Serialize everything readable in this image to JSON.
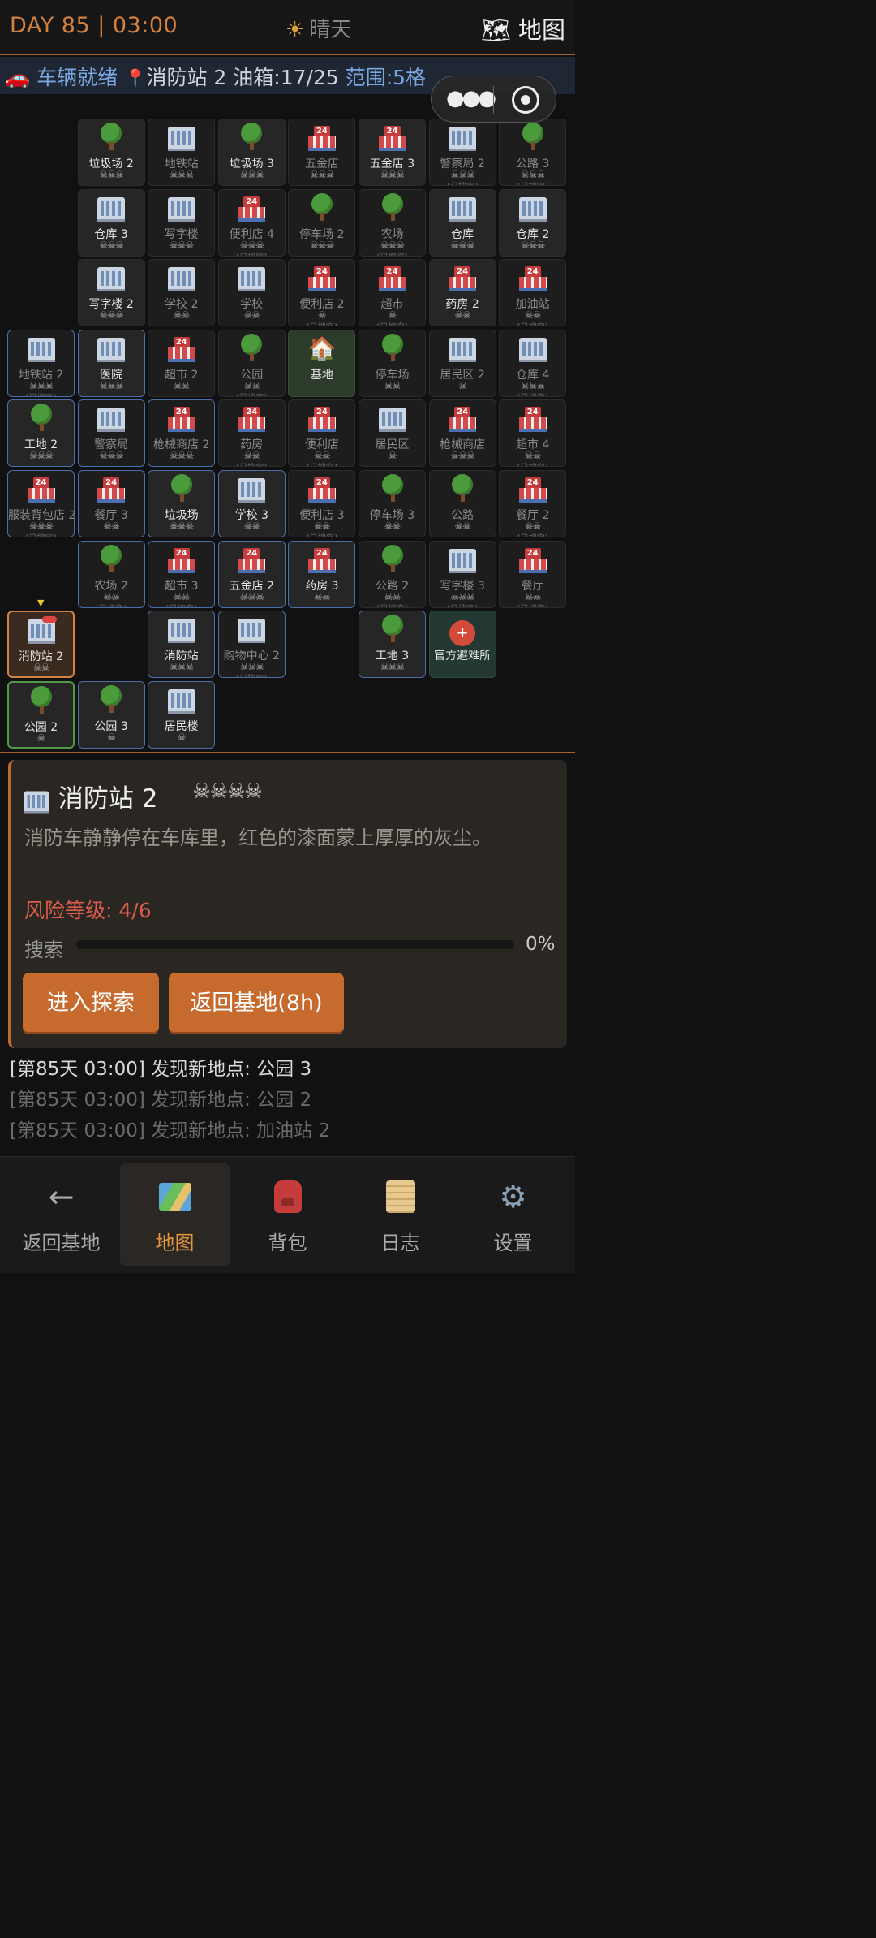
{
  "header": {
    "day_time": "DAY 85 | 03:00",
    "weather": "晴天",
    "map_label": "地图"
  },
  "status": {
    "ready": "车辆就绪",
    "location": "消防站 2",
    "fuel": "油箱:17/25",
    "range": "范围:5格"
  },
  "grid_cells": [
    {
      "c": 1,
      "r": 0,
      "icon": "tree",
      "name": "垃圾场 2",
      "risk": "☠☠☠",
      "dim": false
    },
    {
      "c": 2,
      "r": 0,
      "icon": "building",
      "name": "地铁站",
      "risk": "☠☠☠",
      "dim": true
    },
    {
      "c": 3,
      "r": 0,
      "icon": "tree",
      "name": "垃圾场 3",
      "risk": "☠☠☠",
      "dim": false
    },
    {
      "c": 4,
      "r": 0,
      "icon": "shop",
      "name": "五金店",
      "risk": "☠☠☠",
      "dim": true
    },
    {
      "c": 5,
      "r": 0,
      "icon": "shop",
      "name": "五金店 3",
      "risk": "☠☠☠",
      "dim": false
    },
    {
      "c": 6,
      "r": 0,
      "icon": "building",
      "name": "警察局 2",
      "risk": "☠☠☠",
      "dim": true,
      "searched": "[已搜空]"
    },
    {
      "c": 7,
      "r": 0,
      "icon": "tree",
      "name": "公路 3",
      "risk": "☠☠☠",
      "dim": true,
      "searched": "[已搜空]"
    },
    {
      "c": 1,
      "r": 1,
      "icon": "building",
      "name": "仓库 3",
      "risk": "☠☠☠",
      "dim": false
    },
    {
      "c": 2,
      "r": 1,
      "icon": "building",
      "name": "写字楼",
      "risk": "☠☠☠",
      "dim": true
    },
    {
      "c": 3,
      "r": 1,
      "icon": "shop",
      "name": "便利店 4",
      "risk": "☠☠☠",
      "dim": true,
      "searched": "[已搜空]"
    },
    {
      "c": 4,
      "r": 1,
      "icon": "tree",
      "name": "停车场 2",
      "risk": "☠☠☠",
      "dim": true
    },
    {
      "c": 5,
      "r": 1,
      "icon": "tree",
      "name": "农场",
      "risk": "☠☠☠",
      "dim": true,
      "searched": "[已搜空]"
    },
    {
      "c": 6,
      "r": 1,
      "icon": "building",
      "name": "仓库",
      "risk": "☠☠☠",
      "dim": false
    },
    {
      "c": 7,
      "r": 1,
      "icon": "building",
      "name": "仓库 2",
      "risk": "☠☠☠",
      "dim": false
    },
    {
      "c": 1,
      "r": 2,
      "icon": "building",
      "name": "写字楼 2",
      "risk": "☠☠☠",
      "dim": false
    },
    {
      "c": 2,
      "r": 2,
      "icon": "building",
      "name": "学校 2",
      "risk": "☠☠",
      "dim": true
    },
    {
      "c": 3,
      "r": 2,
      "icon": "building",
      "name": "学校",
      "risk": "☠☠",
      "dim": true
    },
    {
      "c": 4,
      "r": 2,
      "icon": "shop",
      "name": "便利店 2",
      "risk": "☠",
      "dim": true,
      "searched": "[已搜空]"
    },
    {
      "c": 5,
      "r": 2,
      "icon": "shop",
      "name": "超市",
      "risk": "☠",
      "dim": true,
      "searched": "[已搜空]"
    },
    {
      "c": 6,
      "r": 2,
      "icon": "shop",
      "name": "药房 2",
      "risk": "☠☠",
      "dim": false
    },
    {
      "c": 7,
      "r": 2,
      "icon": "shop",
      "name": "加油站",
      "risk": "☠☠",
      "dim": true,
      "searched": "[已搜空]"
    },
    {
      "c": 0,
      "r": 3,
      "icon": "building",
      "name": "地铁站 2",
      "risk": "☠☠☠",
      "dim": true,
      "blue": true,
      "searched": "[已搜空]"
    },
    {
      "c": 1,
      "r": 3,
      "icon": "building",
      "name": "医院",
      "risk": "☠☠☠",
      "dim": false,
      "blue": true
    },
    {
      "c": 2,
      "r": 3,
      "icon": "shop",
      "name": "超市 2",
      "risk": "☠☠",
      "dim": true
    },
    {
      "c": 3,
      "r": 3,
      "icon": "tree",
      "name": "公园",
      "risk": "☠☠",
      "dim": true,
      "searched": "[已搜空]"
    },
    {
      "c": 4,
      "r": 3,
      "icon": "house",
      "name": "基地",
      "risk": "",
      "dim": false,
      "base": true
    },
    {
      "c": 5,
      "r": 3,
      "icon": "tree",
      "name": "停车场",
      "risk": "☠☠",
      "dim": true
    },
    {
      "c": 6,
      "r": 3,
      "icon": "building",
      "name": "居民区 2",
      "risk": "☠",
      "dim": true
    },
    {
      "c": 7,
      "r": 3,
      "icon": "building",
      "name": "仓库 4",
      "risk": "☠☠☠",
      "dim": true,
      "searched": "[已搜空]"
    },
    {
      "c": 0,
      "r": 4,
      "icon": "tree",
      "name": "工地 2",
      "risk": "☠☠☠",
      "dim": false,
      "blue": true
    },
    {
      "c": 1,
      "r": 4,
      "icon": "building",
      "name": "警察局",
      "risk": "☠☠☠",
      "dim": true,
      "blue": true
    },
    {
      "c": 2,
      "r": 4,
      "icon": "shop",
      "name": "枪械商店 2",
      "risk": "☠☠☠",
      "dim": true,
      "blue": true
    },
    {
      "c": 3,
      "r": 4,
      "icon": "shop",
      "name": "药房",
      "risk": "☠☠",
      "dim": true,
      "searched": "[已搜空]"
    },
    {
      "c": 4,
      "r": 4,
      "icon": "shop",
      "name": "便利店",
      "risk": "☠☠",
      "dim": true,
      "searched": "[已搜空]"
    },
    {
      "c": 5,
      "r": 4,
      "icon": "building",
      "name": "居民区",
      "risk": "☠",
      "dim": true
    },
    {
      "c": 6,
      "r": 4,
      "icon": "shop",
      "name": "枪械商店",
      "risk": "☠☠☠",
      "dim": true
    },
    {
      "c": 7,
      "r": 4,
      "icon": "shop",
      "name": "超市 4",
      "risk": "☠☠",
      "dim": true,
      "searched": "[已搜空]"
    },
    {
      "c": 0,
      "r": 5,
      "icon": "shop",
      "name": "服装背包店 2",
      "risk": "☠☠☠",
      "dim": true,
      "blue": true,
      "searched": "[已搜空]"
    },
    {
      "c": 1,
      "r": 5,
      "icon": "shop",
      "name": "餐厅 3",
      "risk": "☠☠",
      "dim": true,
      "blue": true
    },
    {
      "c": 2,
      "r": 5,
      "icon": "tree",
      "name": "垃圾场",
      "risk": "☠☠☠",
      "dim": false,
      "blue": true
    },
    {
      "c": 3,
      "r": 5,
      "icon": "building",
      "name": "学校 3",
      "risk": "☠☠",
      "dim": false,
      "blue": true
    },
    {
      "c": 4,
      "r": 5,
      "icon": "shop",
      "name": "便利店 3",
      "risk": "☠☠",
      "dim": true,
      "searched": "[已搜空]"
    },
    {
      "c": 5,
      "r": 5,
      "icon": "tree",
      "name": "停车场 3",
      "risk": "☠☠",
      "dim": true
    },
    {
      "c": 6,
      "r": 5,
      "icon": "tree",
      "name": "公路",
      "risk": "☠☠",
      "dim": true
    },
    {
      "c": 7,
      "r": 5,
      "icon": "shop",
      "name": "餐厅 2",
      "risk": "☠☠",
      "dim": true,
      "searched": "[已搜空]"
    },
    {
      "c": 1,
      "r": 6,
      "icon": "tree",
      "name": "农场 2",
      "risk": "☠☠",
      "dim": true,
      "blue": true,
      "searched": "[已搜空]"
    },
    {
      "c": 2,
      "r": 6,
      "icon": "shop",
      "name": "超市 3",
      "risk": "☠☠",
      "dim": true,
      "blue": true,
      "searched": "[已搜空]"
    },
    {
      "c": 3,
      "r": 6,
      "icon": "shop",
      "name": "五金店 2",
      "risk": "☠☠☠",
      "dim": false,
      "blue": true
    },
    {
      "c": 4,
      "r": 6,
      "icon": "shop",
      "name": "药房 3",
      "risk": "☠☠",
      "dim": false,
      "blue": true
    },
    {
      "c": 5,
      "r": 6,
      "icon": "tree",
      "name": "公路 2",
      "risk": "☠☠",
      "dim": true,
      "searched": "[已搜空]"
    },
    {
      "c": 6,
      "r": 6,
      "icon": "building",
      "name": "写字楼 3",
      "risk": "☠☠☠",
      "dim": true,
      "searched": "[已搜空]"
    },
    {
      "c": 7,
      "r": 6,
      "icon": "shop",
      "name": "餐厅",
      "risk": "☠☠",
      "dim": true,
      "searched": "[已搜空]"
    },
    {
      "c": 0,
      "r": 7,
      "icon": "building",
      "name": "消防站 2",
      "risk": "☠☠",
      "dim": false,
      "current": true
    },
    {
      "c": 2,
      "r": 7,
      "icon": "building",
      "name": "消防站",
      "risk": "☠☠☠",
      "dim": false,
      "blue": true
    },
    {
      "c": 3,
      "r": 7,
      "icon": "building",
      "name": "购物中心 2",
      "risk": "☠☠☠",
      "dim": true,
      "blue": true,
      "searched": "[已搜空]"
    },
    {
      "c": 5,
      "r": 7,
      "icon": "tree",
      "name": "工地 3",
      "risk": "☠☠☠",
      "dim": false,
      "blue": true
    },
    {
      "c": 6,
      "r": 7,
      "icon": "helmet",
      "name": "官方避难所",
      "risk": "",
      "dim": false,
      "shelter": true
    },
    {
      "c": 0,
      "r": 8,
      "icon": "tree",
      "name": "公园 2",
      "risk": "☠",
      "dim": false,
      "green": true
    },
    {
      "c": 1,
      "r": 8,
      "icon": "tree",
      "name": "公园 3",
      "risk": "☠",
      "dim": false,
      "blue": true
    },
    {
      "c": 2,
      "r": 8,
      "icon": "building",
      "name": "居民楼",
      "risk": "☠",
      "dim": false,
      "blue": true
    }
  ],
  "panel": {
    "title": "消防站 2",
    "skulls": "☠☠☠☠",
    "description": "消防车静静停在车库里，红色的漆面蒙上厚厚的灰尘。",
    "risk_label": "风险等级: 4/6",
    "search_label": "搜索",
    "search_progress": 0,
    "search_pct": "0%",
    "enter_button": "进入探索",
    "return_button": "返回基地(8h)"
  },
  "log": [
    "[第85天 03:00] 发现新地点: 公园 3",
    "[第85天 03:00] 发现新地点: 公园 2",
    "[第85天 03:00] 发现新地点: 加油站 2"
  ],
  "nav": [
    {
      "label": "返回基地",
      "icon": "back-arrow-icon"
    },
    {
      "label": "地图",
      "icon": "map-icon",
      "selected": true
    },
    {
      "label": "背包",
      "icon": "backpack-icon"
    },
    {
      "label": "日志",
      "icon": "scroll-icon"
    },
    {
      "label": "设置",
      "icon": "gear-icon"
    }
  ],
  "colors": {
    "accent": "#d4803f",
    "risk": "#dc5d4b",
    "status_bg": "#1f2734",
    "button": "#c66a2d"
  }
}
